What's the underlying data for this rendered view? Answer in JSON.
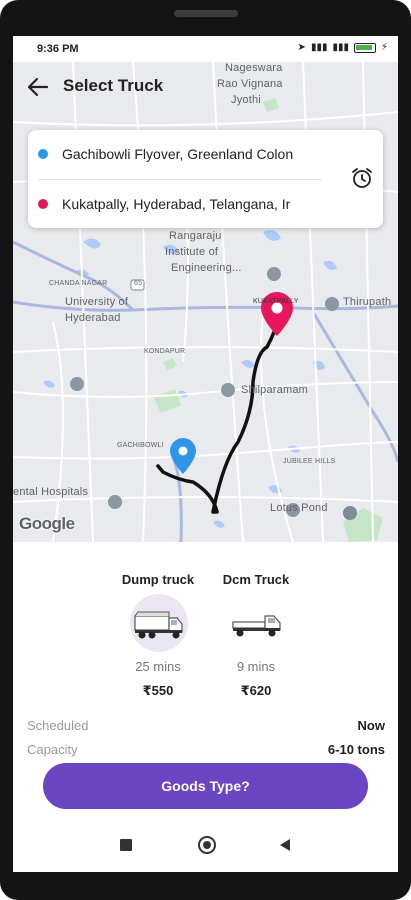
{
  "status_bar": {
    "time": "9:36 PM"
  },
  "header": {
    "title": "Select Truck"
  },
  "route": {
    "pickup": "Gachibowli Flyover, Greenland Colon",
    "drop": "Kukatpally, Hyderabad, Telangana, Ir",
    "pickup_color": "#2f95e8",
    "drop_color": "#e8175d"
  },
  "map": {
    "labels": {
      "nageswara": "Nageswara",
      "rao_vignana": "Rao Vignana",
      "jyothi": "Jyothi",
      "rangaraju": "Rangaraju",
      "institute_of": "Institute of",
      "engineering": "Engineering...",
      "chanda_nagar": "CHANDA NAGAR",
      "route_marker": "65",
      "university_of": "University of",
      "hyderabad": "Hyderabad",
      "kukatpally": "KUKATPALLY",
      "thirupath": "Thirupath",
      "kondapur": "KONDAPUR",
      "shilparamam": "Shilparamam",
      "gachibowli": "GACHIBOWLI",
      "jubilee_hills": "JUBILEE HILLS",
      "hospitals": "ental Hospitals",
      "lotus_pond": "Lotus Pond",
      "google": "Google"
    }
  },
  "trucks": [
    {
      "name": "Dump truck",
      "eta": "25 mins",
      "price": "₹550",
      "selected": true
    },
    {
      "name": "Dcm Truck",
      "eta": "9 mins",
      "price": "₹620",
      "selected": false
    }
  ],
  "details": {
    "scheduled_label": "Scheduled",
    "scheduled_value": "Now",
    "capacity_label": "Capacity",
    "capacity_value": "6-10 tons"
  },
  "actions": {
    "goods_type": "Goods Type?"
  },
  "colors": {
    "accent": "#6a46c3",
    "route_line": "#111111",
    "map_bg": "#e8eaed",
    "selected_truck_bg": "#ece6f4"
  }
}
